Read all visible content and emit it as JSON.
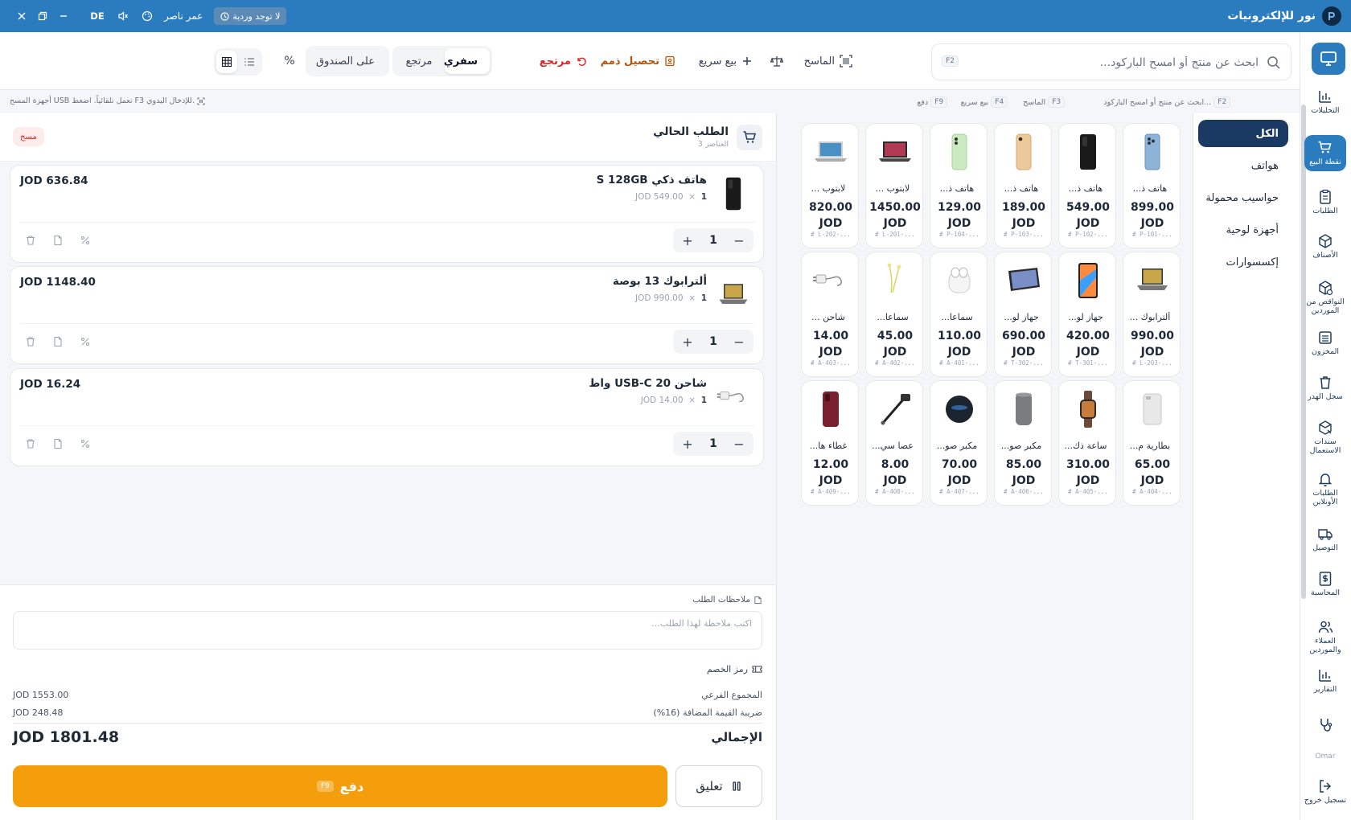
{
  "topbar": {
    "brand_name": "نور للإلكترونيات",
    "drawer_status": "لا توجد وردية",
    "user_name": "عمر ناصر",
    "language": "DE"
  },
  "sidebar": {
    "items": [
      {
        "label": "التحليلات",
        "icon": "bar-chart-icon"
      },
      {
        "label": "نقطة البيع",
        "icon": "cart-icon",
        "active": true
      },
      {
        "label": "الطلبات",
        "icon": "clipboard-icon"
      },
      {
        "label": "الأصناف",
        "icon": "box-icon"
      },
      {
        "label": "النواقص من الموردين",
        "icon": "package-alert-icon"
      },
      {
        "label": "المخزون",
        "icon": "warehouse-icon"
      },
      {
        "label": "سجل الهدر",
        "icon": "trash-icon"
      },
      {
        "label": "سندات الاستعمال",
        "icon": "receipt-icon"
      },
      {
        "label": "الطلبات الأونلاين",
        "icon": "bell-icon"
      },
      {
        "label": "التوصيل",
        "icon": "truck-icon"
      },
      {
        "label": "المحاسبة",
        "icon": "dollar-icon"
      },
      {
        "label": "العملاء والموردين",
        "icon": "users-icon"
      },
      {
        "label": "التقارير",
        "icon": "report-chart-icon"
      }
    ],
    "user_short": "Omar",
    "logout_label": "تسجيل خروج"
  },
  "toolbar": {
    "search_placeholder": "ابحث عن منتج أو امسح الباركود...",
    "search_shortcut": "F2",
    "scanner_label": "الماسح",
    "quick_sale_label": "بيع سريع",
    "collect_debt_label": "تحصيل ذمم",
    "return_label": "مرتجع",
    "order_types": [
      {
        "label": "سفري",
        "selected": true
      },
      {
        "label": "مرتجع",
        "selected": false
      },
      {
        "label": "على الصندوق",
        "selected": false
      }
    ],
    "percent_label": "%"
  },
  "hints": {
    "items": [
      {
        "key": "F2",
        "text": "ابحث عن منتج أو امسح الباركود..."
      },
      {
        "key": "F3",
        "text": "الماسح"
      },
      {
        "key": "F4",
        "text": "بيع سريع"
      },
      {
        "key": "F9",
        "text": "دفع"
      }
    ],
    "scanner_note": "أجهزة المسح USB تعمل تلقائياً. اضغط F3 للإدخال اليدوي."
  },
  "categories": [
    {
      "label": "الكل",
      "selected": true
    },
    {
      "label": "هواتف",
      "selected": false
    },
    {
      "label": "حواسيب محمولة",
      "selected": false
    },
    {
      "label": "أجهزة لوحية",
      "selected": false
    },
    {
      "label": "إكسسوارات",
      "selected": false
    }
  ],
  "products": [
    {
      "name": "هاتف ذ...",
      "price": "899.00",
      "currency": "JOD",
      "sku": "# P-101-...",
      "img": "phone-blue"
    },
    {
      "name": "هاتف ذ...",
      "price": "549.00",
      "currency": "JOD",
      "sku": "# P-102-...",
      "img": "phone-black"
    },
    {
      "name": "هاتف ذ...",
      "price": "189.00",
      "currency": "JOD",
      "sku": "# P-103-...",
      "img": "phone-gold"
    },
    {
      "name": "هاتف ذ...",
      "price": "129.00",
      "currency": "JOD",
      "sku": "# P-104-...",
      "img": "phone-green"
    },
    {
      "name": "لابتوب ...",
      "price": "1450.00",
      "currency": "JOD",
      "sku": "# L-201-...",
      "img": "laptop-dark"
    },
    {
      "name": "لابتوب ...",
      "price": "820.00",
      "currency": "JOD",
      "sku": "# L-202-...",
      "img": "laptop-silver"
    },
    {
      "name": "ألترابوك ...",
      "price": "990.00",
      "currency": "JOD",
      "sku": "# L-203-...",
      "img": "laptop-open"
    },
    {
      "name": "جهاز لو...",
      "price": "420.00",
      "currency": "JOD",
      "sku": "# T-301-...",
      "img": "tablet-color"
    },
    {
      "name": "جهاز لو...",
      "price": "690.00",
      "currency": "JOD",
      "sku": "# T-302-...",
      "img": "tablet-flat"
    },
    {
      "name": "سماعا...",
      "price": "110.00",
      "currency": "JOD",
      "sku": "# A-401-...",
      "img": "earbuds"
    },
    {
      "name": "سماعا...",
      "price": "45.00",
      "currency": "JOD",
      "sku": "# A-402-...",
      "img": "wired-earphones"
    },
    {
      "name": "شاحن ...",
      "price": "14.00",
      "currency": "JOD",
      "sku": "# A-403-...",
      "img": "charger"
    },
    {
      "name": "بطارية م...",
      "price": "65.00",
      "currency": "JOD",
      "sku": "# A-404-...",
      "img": "powerbank"
    },
    {
      "name": "ساعة ذك...",
      "price": "310.00",
      "currency": "JOD",
      "sku": "# A-405-...",
      "img": "watch"
    },
    {
      "name": "مكبر صو...",
      "price": "85.00",
      "currency": "JOD",
      "sku": "# A-406-...",
      "img": "speaker-grey"
    },
    {
      "name": "مكبر صو...",
      "price": "70.00",
      "currency": "JOD",
      "sku": "# A-407-...",
      "img": "speaker-round"
    },
    {
      "name": "عصا سي...",
      "price": "8.00",
      "currency": "JOD",
      "sku": "# A-408-...",
      "img": "selfie-stick"
    },
    {
      "name": "غطاء ها...",
      "price": "12.00",
      "currency": "JOD",
      "sku": "# A-409-...",
      "img": "phone-case"
    }
  ],
  "cart": {
    "title": "الطلب الحالي",
    "subtitle": "3 العناصر",
    "clear_label": "مسح",
    "items": [
      {
        "name": "هاتف ذكي S 128GB",
        "qty_label": "1",
        "unit_price": "JOD 549.00",
        "total": "JOD 636.84",
        "qty": "1",
        "img": "phone-black"
      },
      {
        "name": "ألترابوك 13 بوصة",
        "qty_label": "1",
        "unit_price": "JOD 990.00",
        "total": "JOD 1148.40",
        "qty": "1",
        "img": "laptop-open"
      },
      {
        "name": "شاحن USB-C 20 واط",
        "qty_label": "1",
        "unit_price": "JOD 14.00",
        "total": "JOD 16.24",
        "qty": "1",
        "img": "charger"
      }
    ],
    "notes_label": "ملاحظات الطلب",
    "notes_placeholder": "اكتب ملاحظة لهذا الطلب...",
    "discount_label": "رمز الخصم",
    "subtotal_label": "المجموع الفرعي",
    "subtotal_value": "JOD 1553.00",
    "tax_label": "ضريبة القيمة المضافة (16%)",
    "tax_value": "JOD 248.48",
    "total_label": "الإجمالي",
    "total_value": "JOD 1801.48",
    "pay_label": "دفع",
    "pay_shortcut": "F9",
    "hold_label": "تعليق"
  },
  "colors": {
    "primary": "#2b7bbf",
    "navy": "#1b3a63",
    "pay": "#f59e0b",
    "danger": "#dc2626",
    "collect": "#b45309"
  }
}
